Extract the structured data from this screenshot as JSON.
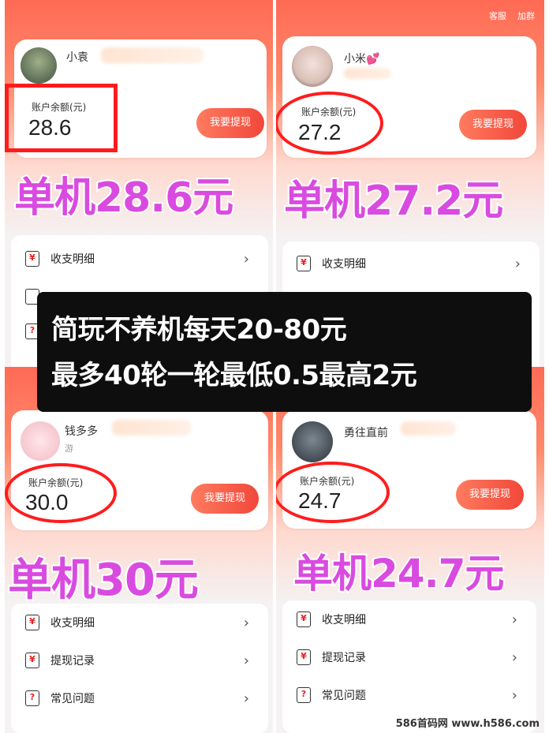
{
  "header_actions": {
    "service": "客服",
    "group": "加群"
  },
  "coin_symbol": "¥",
  "balance_label": "账户余额(元)",
  "withdraw_label": "我要提现",
  "menu": {
    "income": "收支明细",
    "withdraw_records": "提现记录",
    "faq": "常见问题",
    "chevron": "›"
  },
  "panels": [
    {
      "username": "小袁",
      "balance": "28.6",
      "big_text": "单机28.6元"
    },
    {
      "username": "小米💕",
      "balance": "27.2",
      "big_text": "单机27.2元"
    },
    {
      "username": "钱多多",
      "sub": "游",
      "balance": "30.0",
      "big_text": "单机30元"
    },
    {
      "username": "勇往直前",
      "balance": "24.7",
      "big_text": "单机24.7元"
    }
  ],
  "overlay": {
    "line1": "简玩不养机每天20-80元",
    "line2": "最多40轮一轮最低0.5最高2元"
  },
  "watermark": "586首码网 www.h586.com",
  "colors": {
    "accent": "#f1473a",
    "highlight": "#ff1c1c",
    "big_text": "#d94be0"
  }
}
